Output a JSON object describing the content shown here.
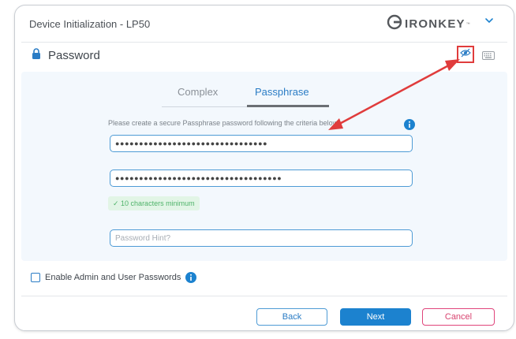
{
  "window": {
    "title": "Device Initialization - LP50",
    "brand": "IRONKEY",
    "brand_tm": "™"
  },
  "section": {
    "title": "Password"
  },
  "tabs": [
    {
      "label": "Complex",
      "active": false
    },
    {
      "label": "Passphrase",
      "active": true
    }
  ],
  "instruction": "Please create a secure Passphrase password following the criteria below.",
  "password_field": {
    "value": "●●●●●●●●●●●●●●●●●●●●●●●●●●●●●●●●"
  },
  "confirm_field": {
    "value": "●●●●●●●●●●●●●●●●●●●●●●●●●●●●●●●●●●●"
  },
  "requirement": "✓ 10 characters minimum",
  "hint_field": {
    "placeholder": "Password Hint?",
    "value": ""
  },
  "admin_option": {
    "label": "Enable Admin and User Passwords",
    "checked": false
  },
  "buttons": {
    "back": "Back",
    "next": "Next",
    "cancel": "Cancel"
  },
  "colors": {
    "accent": "#1c82cf",
    "annotation": "#e03c3c",
    "success": "#4fb36a",
    "cancel": "#d8436f"
  }
}
